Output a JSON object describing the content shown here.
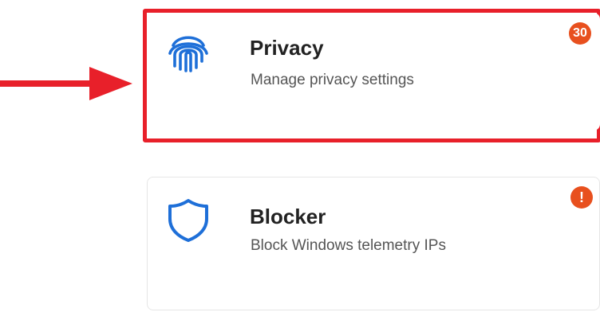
{
  "cards": [
    {
      "title": "Privacy",
      "description": "Manage privacy settings",
      "icon": "fingerprint-icon",
      "badge": "30",
      "highlighted": true
    },
    {
      "title": "Blocker",
      "description": "Block Windows telemetry IPs",
      "icon": "shield-icon",
      "badge": "!"
    }
  ],
  "colors": {
    "highlight": "#e8202a",
    "accent": "#1e6fd8",
    "badge": "#e8501e",
    "arrow": "#e8202a"
  }
}
